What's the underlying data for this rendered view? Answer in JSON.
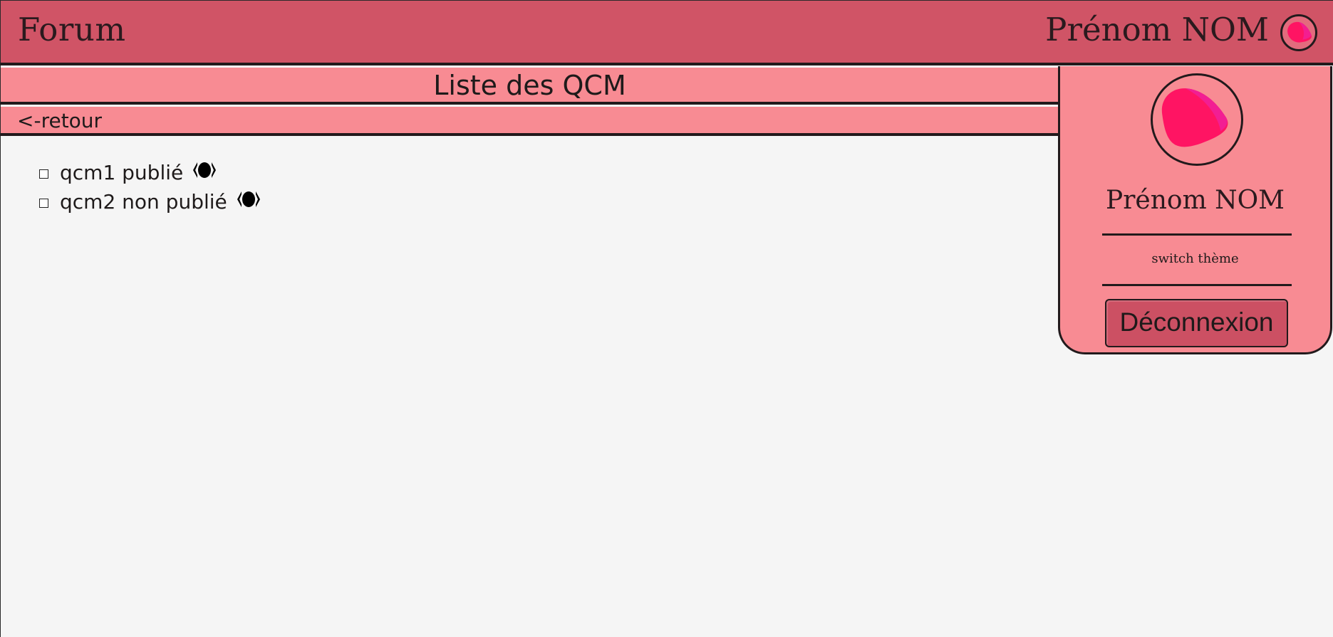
{
  "header": {
    "brand": "Forum",
    "user_name": "Prénom NOM"
  },
  "page": {
    "title": "Liste des QCM",
    "back_link": "<-retour"
  },
  "qcm_list": [
    {
      "label": "qcm1 publié",
      "checked": false,
      "icon": "eye-icon"
    },
    {
      "label": "qcm2 non publié",
      "checked": false,
      "icon": "eye-icon"
    }
  ],
  "side_panel": {
    "user_name": "Prénom NOM",
    "switch_theme": "switch thème",
    "logout_label": "Déconnexion"
  },
  "colors": {
    "header_bg": "#d05466",
    "bar_bg": "#f88b93",
    "page_bg": "#f5f5f5",
    "button_bg": "#cc5063",
    "avatar_accent": "#ff1463",
    "border": "#221a1c"
  }
}
